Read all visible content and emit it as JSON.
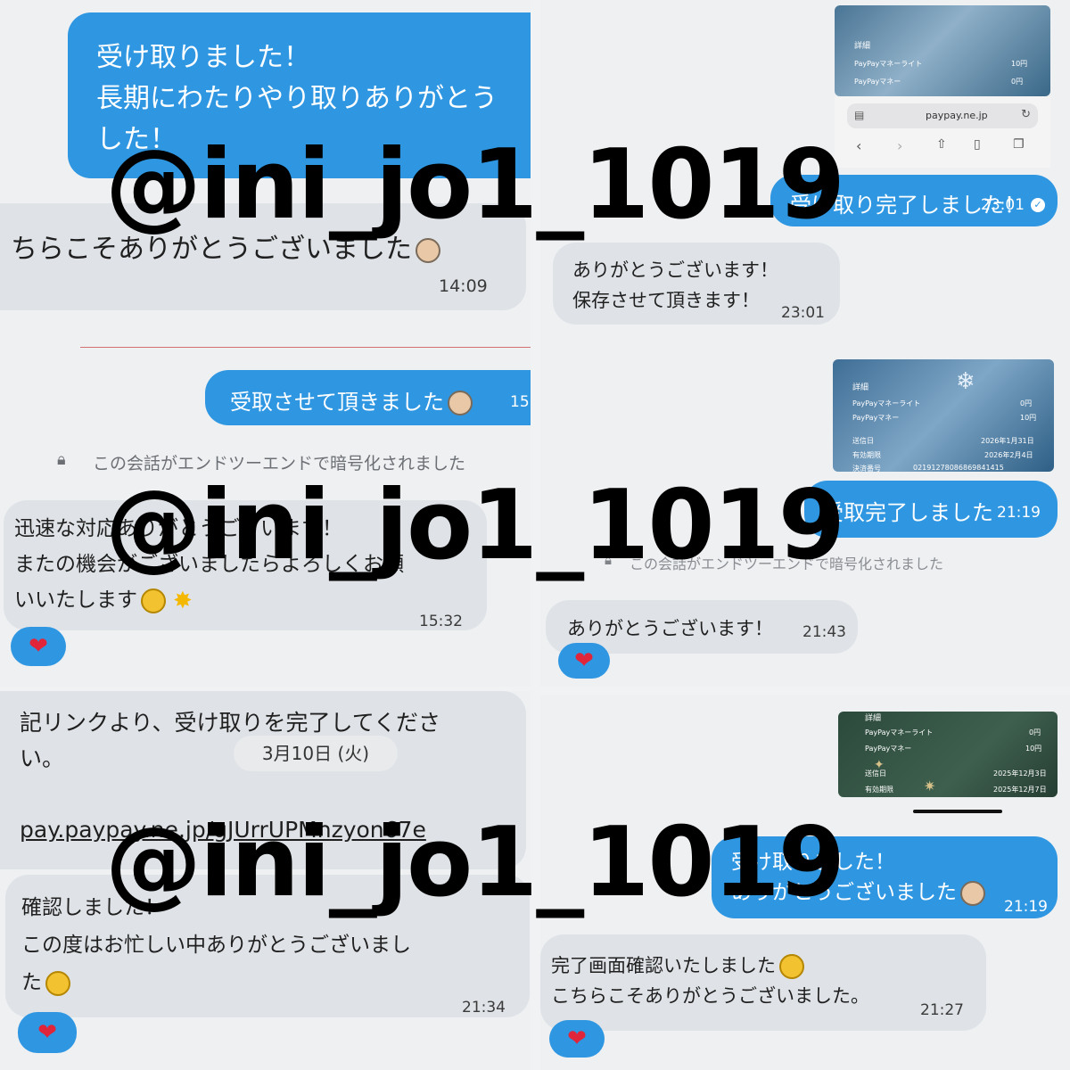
{
  "watermark": "@ini_jo1_1019",
  "panel1": {
    "outgoing": [
      "受け取りました！",
      "長期にわたりやり取りありがとう",
      "した！"
    ],
    "incoming": "ちらこそありがとうございました",
    "incoming_time": "14:09"
  },
  "panel2": {
    "card": {
      "detail": "詳細",
      "row1_label": "PayPayマネーライト",
      "row1_value": "10円",
      "row2_label": "PayPayマネー",
      "row2_value": "0円"
    },
    "browser": {
      "url": "paypay.ne.jp"
    },
    "outgoing": "受け取り完了しました！",
    "outgoing_time": "23:01",
    "incoming": [
      "ありがとうございます！",
      "保存させて頂きます！"
    ],
    "incoming_time": "23:01"
  },
  "panel3": {
    "outgoing": "受取させて頂きました",
    "outgoing_time": "15",
    "encrypted_note": "この会話がエンドツーエンドで暗号化されました",
    "incoming": [
      "迅速な対応ありがとうございます！",
      "またの機会がございましたらよろしくお願",
      "いいたします"
    ],
    "incoming_time": "15:32",
    "reaction": "❤"
  },
  "panel4": {
    "card": {
      "detail": "詳細",
      "row1_label": "PayPayマネーライト",
      "row1_value": "0円",
      "row2_label": "PayPayマネー",
      "row2_value": "10円",
      "row3_label": "送信日",
      "row3_value": "2026年1月31日",
      "row4_label": "有効期限",
      "row4_value": "2026年2月4日",
      "row5_label": "決済番号",
      "row5_value": "02191278086869841415"
    },
    "outgoing": "受取完了しました",
    "outgoing_time": "21:19",
    "encrypted_note": "この会話がエンドツーエンドで暗号化されました",
    "incoming": "ありがとうございます！",
    "incoming_time": "21:43",
    "reaction": "❤"
  },
  "panel5": {
    "incoming_top": [
      "記リンクより、受け取りを完了してくださ",
      "い。",
      "",
      "pay.paypay.ne.jp/gJUrrUPMnzyon67e"
    ],
    "date_chip": "3月10日 (火)",
    "incoming": [
      "確認しました！",
      "この度はお忙しい中ありがとうございまし",
      "た"
    ],
    "incoming_time": "21:34",
    "reaction": "❤"
  },
  "panel6": {
    "card": {
      "detail": "詳細",
      "row1_label": "PayPayマネーライト",
      "row1_value": "0円",
      "row2_label": "PayPayマネー",
      "row2_value": "10円",
      "row3_label": "送信日",
      "row3_value": "2025年12月3日",
      "row4_label": "有効期限",
      "row4_value": "2025年12月7日"
    },
    "outgoing": [
      "受け取りました！",
      "ありがとうございました"
    ],
    "outgoing_time": "21:19",
    "incoming": [
      "完了画面確認いたしました",
      "こちらこそありがとうございました。"
    ],
    "incoming_time": "21:27",
    "reaction": "❤"
  }
}
